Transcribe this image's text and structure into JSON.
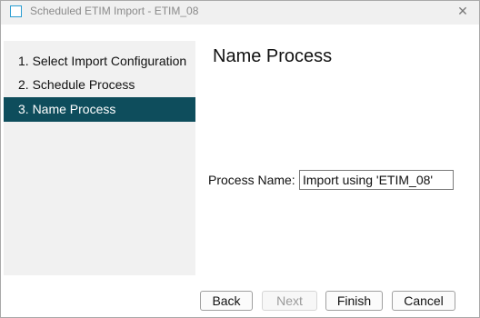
{
  "window": {
    "title": "Scheduled ETIM Import - ETIM_08",
    "close_symbol": "✕"
  },
  "sidebar": {
    "steps": [
      {
        "label": "1. Select Import Configuration",
        "active": false
      },
      {
        "label": "2. Schedule Process",
        "active": false
      },
      {
        "label": "3. Name Process",
        "active": true
      }
    ]
  },
  "main": {
    "heading": "Name Process",
    "process_name_label": "Process Name:",
    "process_name_value": "Import using 'ETIM_08'"
  },
  "footer": {
    "back_label": "Back",
    "next_label": "Next",
    "finish_label": "Finish",
    "cancel_label": "Cancel"
  },
  "colors": {
    "active_step_bg": "#0e4d5c",
    "sidebar_bg": "#f1f1f1"
  }
}
